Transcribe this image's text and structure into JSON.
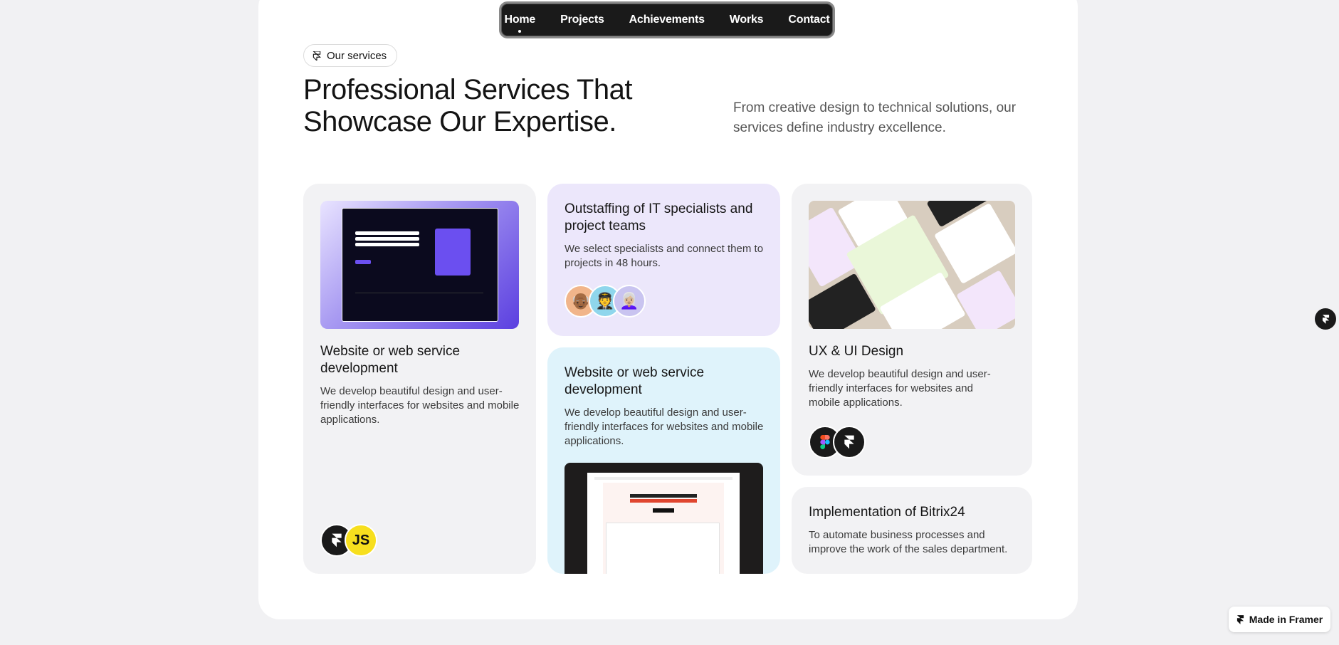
{
  "nav": {
    "items": [
      {
        "label": "Home",
        "active": true
      },
      {
        "label": "Projects"
      },
      {
        "label": "Achievements"
      },
      {
        "label": "Works"
      },
      {
        "label": "Contact"
      }
    ]
  },
  "section": {
    "pill_label": "Our services",
    "pill_icon": "framer-icon",
    "headline": "Professional Services That Showcase Our Expertise.",
    "subline": "From creative design to technical solutions, our services define industry excellence."
  },
  "cards": [
    {
      "title": "Website or web service development",
      "description": "We develop beautiful design and user-friendly interfaces for websites and mobile applications.",
      "tech": [
        "framer-icon",
        "JS"
      ],
      "color": "#f2f2f4"
    },
    {
      "title": "Outstaffing of IT specialists and project teams",
      "description": "We select specialists and connect them to projects in 48 hours.",
      "avatars": [
        "👴🏾",
        "🧑‍✈️",
        "👩🏼‍🦳"
      ],
      "color": "#ece7fb"
    },
    {
      "title": "Website or web service development",
      "description": "We develop beautiful design and user-friendly interfaces for websites and mobile applications.",
      "color": "#dff3fb"
    },
    {
      "title": "UX & UI Design",
      "description": "We develop beautiful design and user-friendly interfaces for websites and mobile applications.",
      "tech": [
        "figma-icon",
        "framer-icon"
      ],
      "color": "#f2f2f4"
    },
    {
      "title": "Implementation of Bitrix24",
      "description": "To automate business processes and improve the work of the sales department.",
      "color": "#f2f2f4"
    }
  ],
  "badges": {
    "made_in": "Made in Framer"
  }
}
